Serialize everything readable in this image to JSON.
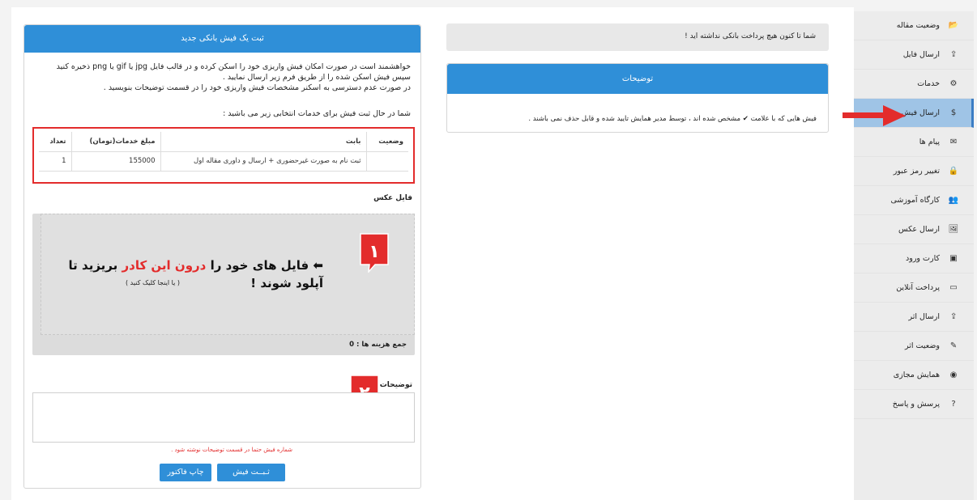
{
  "sidebar": {
    "items": [
      {
        "label": "وضعیت مقاله",
        "icon": "folder-open-icon",
        "glyph": "📂"
      },
      {
        "label": "ارسال فایل",
        "icon": "upload-icon",
        "glyph": "⇪"
      },
      {
        "label": "خدمات",
        "icon": "services-icon",
        "glyph": "⚙"
      },
      {
        "label": "ارسال فیش",
        "icon": "dollar-icon",
        "glyph": "$"
      },
      {
        "label": "پیام ها",
        "icon": "envelope-icon",
        "glyph": "✉"
      },
      {
        "label": "تغییر رمز عبور",
        "icon": "lock-icon",
        "glyph": "🔒"
      },
      {
        "label": "کارگاه آموزشی",
        "icon": "users-icon",
        "glyph": "👥"
      },
      {
        "label": "ارسال عکس",
        "icon": "image-icon",
        "glyph": "🖼"
      },
      {
        "label": "کارت ورود",
        "icon": "id-card-icon",
        "glyph": "▣"
      },
      {
        "label": "پرداخت آنلاین",
        "icon": "credit-card-icon",
        "glyph": "▭"
      },
      {
        "label": "ارسال اثر",
        "icon": "upload-box-icon",
        "glyph": "⇪"
      },
      {
        "label": "وضعیت اثر",
        "icon": "edit-icon",
        "glyph": "✎"
      },
      {
        "label": "همایش مجازی",
        "icon": "globe-icon",
        "glyph": "◉"
      },
      {
        "label": "پرسش و پاسخ",
        "icon": "question-icon",
        "glyph": "?"
      }
    ]
  },
  "alert": {
    "text": "شما تا کنون هیچ پرداخت بانکی نداشته اید !"
  },
  "desc_panel": {
    "title": "توضیحات",
    "body": "فیش هایی که با علامت ✔ مشخص شده اند ، توسط مدیر همایش تایید شده و قابل حذف نمی باشند ."
  },
  "main": {
    "title": "ثبت یک فیش بانکی جدید",
    "intro_line1": "خواهشمند است در صورت امکان فیش واریزی خود را اسکن کرده و در قالب فایل jpg یا gif یا png ذخیره کنید",
    "intro_line2": "سپس فیش اسکن شده را از طریق فرم زیر ارسال نمایید .",
    "intro_line3": "در صورت عدم دسترسی به اسکنر مشخصات فیش واریزی خود را در قسمت توضیحات بنویسید .",
    "services_line": "شما در حال ثبت فیش برای خدمات انتخابی زیر می باشید :",
    "table": {
      "headers": {
        "status": "وضعیت",
        "title": "بابت",
        "amount": "مبلغ خدمات(تومان)",
        "count": "تعداد"
      },
      "rows": [
        {
          "status": "",
          "title": "ثبت نام به صورت غیرحضوری + ارسال و داوری مقاله اول",
          "amount": "155000",
          "count": "1"
        }
      ]
    },
    "photo_label": "فایل عکس",
    "dropzone": {
      "text_a": "فایل های خود را ",
      "text_red": "درون این کادر",
      "text_b": " بریزید تا",
      "text_line2": "آپلود شوند !",
      "hint": "( یا اینجا کلیک کنید )",
      "badge1": "۱",
      "badge2": "۲"
    },
    "sum_label": "جمع هزینه ها : 0",
    "notes_label": "توضیحات",
    "warning": "شماره فیش حتما در قسمت توضیحات نوشته شود .",
    "submit_label": "ثـبــت فیش",
    "print_label": "چاپ فاکتور"
  },
  "colors": {
    "accent": "#2f8fd8",
    "highlight": "#e32c2c",
    "active_item": "#9fc4e6"
  }
}
